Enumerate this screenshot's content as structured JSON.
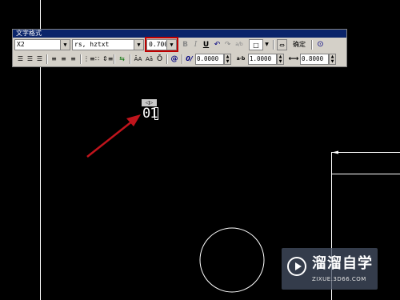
{
  "toolbar": {
    "title": "文字格式",
    "style_name": "X2",
    "font_name": "rs, hztxt",
    "text_height": "0.7000",
    "bold": "B",
    "italic": "I",
    "underline": "U",
    "undo": "↶",
    "redo": "↷",
    "stack": "a/b",
    "color_swatch": "□",
    "ruler": "⇔",
    "ok_label": "确定",
    "options": "⊙",
    "oblique_angle": "0.0000",
    "tracking": "1.0000",
    "width_factor": "0.8000",
    "oblique_icon": "0/",
    "tracking_icon": "a·b",
    "width_icon": "⟷",
    "insert_field": "@",
    "upper": "ĀA",
    "lower": "Aā",
    "overline": "Ō"
  },
  "drawing": {
    "text_value": "01",
    "handle_glyph": "◁▷"
  },
  "colors": {
    "background": "#000000",
    "arrow": "#c0141c",
    "highlight": "#c00000"
  },
  "watermark": {
    "title": "溜溜自学",
    "subtitle": "ZIXUE.3D66.COM"
  }
}
